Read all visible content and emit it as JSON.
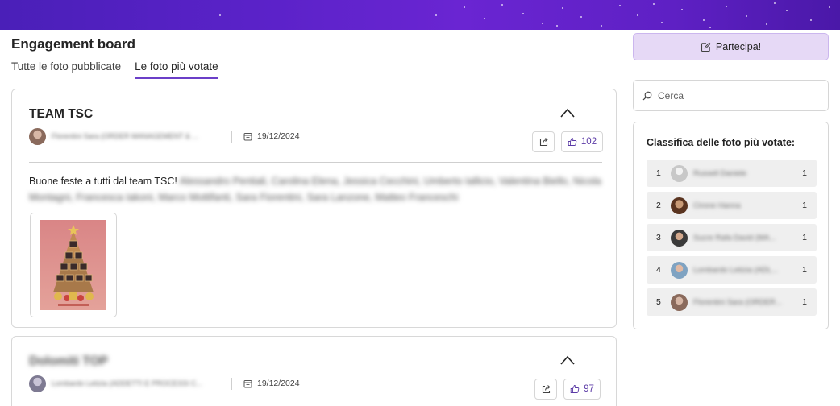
{
  "board": {
    "title": "Engagement board"
  },
  "tabs": [
    {
      "label": "Tutte le foto pubblicate",
      "active": false
    },
    {
      "label": "Le foto più votate",
      "active": true
    }
  ],
  "posts": [
    {
      "title": "TEAM TSC",
      "author": "Florentini Sara (ORDER MANAGEMENT & ...",
      "date": "19/12/2024",
      "likes": "102",
      "text_visible": "Buone feste a tutti dal team TSC!",
      "text_blurred": "Alessandro Pentiali, Carolina Elena, Jessica Cecchini, Umberto Iallicio, Valentina Biello, Nicola Montagni, Francesca Iakoni, Marco Mottifanti, Sara Fiorentini, Sara Lanzone, Matteo Franceschi"
    },
    {
      "title": "Dolomiti TOP",
      "author": "Lombardo Letizia (ADDETTI E PROCESSI C...",
      "date": "19/12/2024",
      "likes": "97"
    }
  ],
  "sidebar": {
    "join_label": "Partecipa!",
    "search_placeholder": "Cerca",
    "ranking_title": "Classifica delle foto più votate:",
    "ranking": [
      {
        "pos": "1",
        "name": "Russell Daniele",
        "votes": "1"
      },
      {
        "pos": "2",
        "name": "Cirone Hanna",
        "votes": "1"
      },
      {
        "pos": "3",
        "name": "Sucre Rafa David (MA...",
        "votes": "1"
      },
      {
        "pos": "4",
        "name": "Lombardo Letizia (ADL...",
        "votes": "1"
      },
      {
        "pos": "5",
        "name": "Florentini Sara (ORDER...",
        "votes": "1"
      }
    ]
  },
  "colors": {
    "accent": "#6b3fc8",
    "like_count": "#5b3aa6",
    "join_bg": "#e6d9f6"
  }
}
